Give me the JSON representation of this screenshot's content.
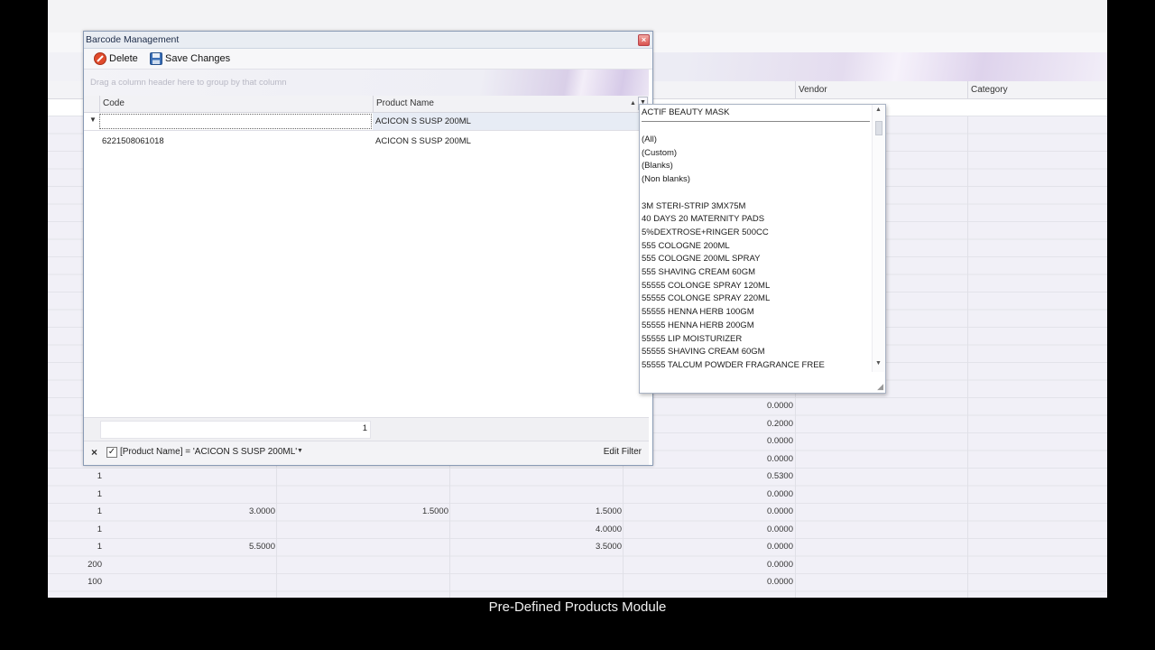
{
  "background_grid": {
    "columns": {
      "vendor": "Vendor",
      "category": "Category"
    },
    "right_values": [
      "0.0000",
      "0.2000",
      "0.0000",
      "0.0000",
      "0.5300",
      "0.0000",
      "0.0000",
      "0.0000",
      "0.0000",
      "0.0000",
      "0.0000"
    ],
    "rows": [
      {
        "a": "1",
        "b": "",
        "c": "",
        "d": ""
      },
      {
        "a": "1",
        "b": "",
        "c": "",
        "d": ""
      },
      {
        "a": "1",
        "b": "3.0000",
        "c": "1.5000",
        "d": "1.5000"
      },
      {
        "a": "1",
        "b": "",
        "c": "",
        "d": "4.0000"
      },
      {
        "a": "1",
        "b": "5.5000",
        "c": "",
        "d": "3.5000"
      },
      {
        "a": "200",
        "b": "",
        "c": "",
        "d": ""
      },
      {
        "a": "100",
        "b": "",
        "c": "",
        "d": ""
      }
    ]
  },
  "window": {
    "title": "Barcode Management",
    "toolbar": {
      "delete_label": "Delete",
      "save_label": "Save Changes"
    },
    "group_panel_text": "Drag a column header here to group by that column",
    "columns": {
      "code": "Code",
      "product_name": "Product Name"
    },
    "filter_row": {
      "product_name": "ACICON S SUSP 200ML"
    },
    "rows": [
      {
        "code": "6221508061018",
        "product_name": "ACICON S SUSP 200ML"
      }
    ],
    "footer_count": "1",
    "filter_expression": "[Product Name] = 'ACICON S SUSP 200ML'",
    "edit_filter_label": "Edit Filter"
  },
  "popup": {
    "search_value": "ACTIF BEAUTY MASK",
    "special_items": [
      "(All)",
      "(Custom)",
      "(Blanks)",
      "(Non blanks)"
    ],
    "items": [
      "3M STERI-STRIP 3MX75M",
      "40 DAYS 20 MATERNITY PADS",
      "5%DEXTROSE+RINGER 500CC",
      "555 COLOGNE 200ML",
      "555 COLOGNE 200ML SPRAY",
      "555 SHAVING CREAM 60GM",
      "55555 COLONGE SPRAY 120ML",
      "55555 COLONGE SPRAY 220ML",
      "55555 HENNA HERB 100GM",
      "55555 HENNA HERB 200GM",
      "55555 LIP MOISTURIZER",
      "55555 SHAVING CREAM 60GM",
      "55555 TALCUM POWDER FRAGRANCE FREE"
    ]
  },
  "caption": "Pre-Defined Products Module"
}
